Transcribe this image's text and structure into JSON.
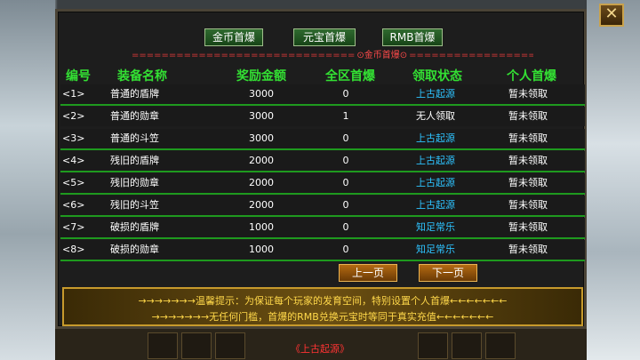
{
  "close_label": "✕",
  "tabs": [
    {
      "label": "金币首爆"
    },
    {
      "label": "元宝首爆"
    },
    {
      "label": "RMB首爆"
    }
  ],
  "subtitle": {
    "left": "==============================",
    "center": "⊙金币首爆⊙",
    "right": "=============================="
  },
  "headers": {
    "no": "编号",
    "name": "装备名称",
    "reward": "奖励金额",
    "server_first": "全区首爆",
    "claim_status": "领取状态",
    "personal_first": "个人首爆"
  },
  "rows": [
    {
      "no": "<1>",
      "name": "普通的盾牌",
      "reward": "3000",
      "server_first": "0",
      "claim_status": "上古起源",
      "personal_first": "暂未领取"
    },
    {
      "no": "<2>",
      "name": "普通的勋章",
      "reward": "3000",
      "server_first": "1",
      "claim_status": "无人领取",
      "personal_first": "暂未领取"
    },
    {
      "no": "<3>",
      "name": "普通的斗笠",
      "reward": "3000",
      "server_first": "0",
      "claim_status": "上古起源",
      "personal_first": "暂未领取"
    },
    {
      "no": "<4>",
      "name": "残旧的盾牌",
      "reward": "2000",
      "server_first": "0",
      "claim_status": "上古起源",
      "personal_first": "暂未领取"
    },
    {
      "no": "<5>",
      "name": "残旧的勋章",
      "reward": "2000",
      "server_first": "0",
      "claim_status": "上古起源",
      "personal_first": "暂未领取"
    },
    {
      "no": "<6>",
      "name": "残旧的斗笠",
      "reward": "2000",
      "server_first": "0",
      "claim_status": "上古起源",
      "personal_first": "暂未领取"
    },
    {
      "no": "<7>",
      "name": "破损的盾牌",
      "reward": "1000",
      "server_first": "0",
      "claim_status": "知足常乐",
      "personal_first": "暂未领取"
    },
    {
      "no": "<8>",
      "name": "破损的勋章",
      "reward": "1000",
      "server_first": "0",
      "claim_status": "知足常乐",
      "personal_first": "暂未领取"
    }
  ],
  "pagination": {
    "prev": "上一页",
    "next": "下一页"
  },
  "tip": {
    "line1": "→→→→→→→温馨提示：为保证每个玩家的发育空间，特别设置个人首爆←←←←←←←",
    "line2": "→→→→→→→无任何门槛，首爆的RMB兑换元宝时等同于真实充值←←←←←←←"
  },
  "bottom_label": "《上古起源》",
  "colors": {
    "header_green": "#33e033",
    "status_blue": "#2ec3ff",
    "tip_yellow": "#ffd84a",
    "subtitle_red": "#e23b3b"
  }
}
